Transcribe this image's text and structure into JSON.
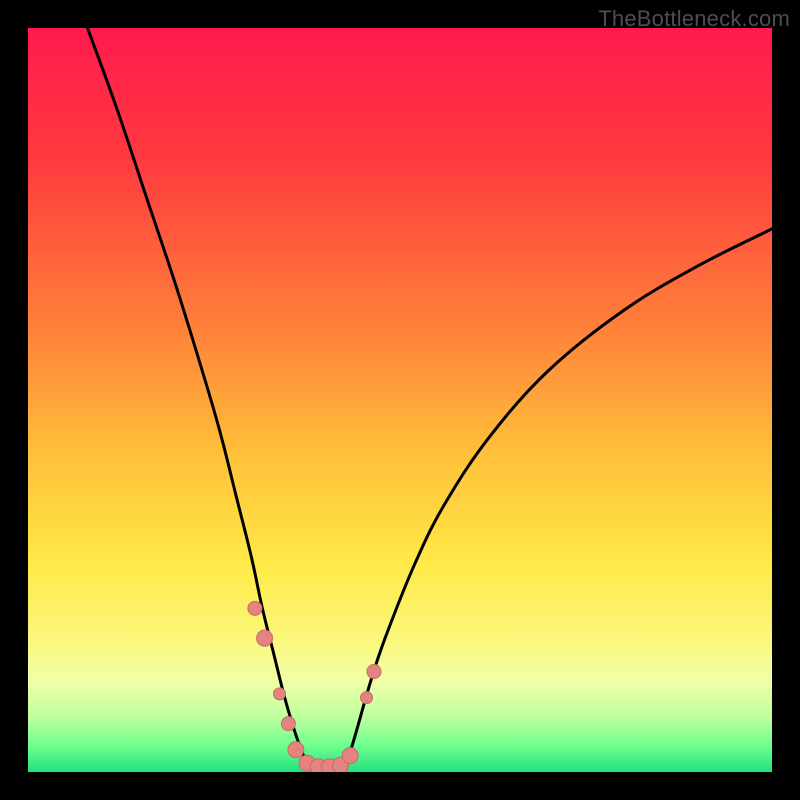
{
  "watermark": "TheBottleneck.com",
  "chart_data": {
    "type": "line",
    "title": "",
    "xlabel": "",
    "ylabel": "",
    "xlim": [
      0,
      100
    ],
    "ylim": [
      0,
      100
    ],
    "grid": false,
    "gradient_stops": [
      {
        "offset": 0,
        "color": "#ff1a4d"
      },
      {
        "offset": 0.18,
        "color": "#ff3b3f"
      },
      {
        "offset": 0.4,
        "color": "#ff803a"
      },
      {
        "offset": 0.58,
        "color": "#ffc23a"
      },
      {
        "offset": 0.72,
        "color": "#ffe947"
      },
      {
        "offset": 0.82,
        "color": "#fbf77a"
      },
      {
        "offset": 0.88,
        "color": "#efffa8"
      },
      {
        "offset": 0.93,
        "color": "#b8ff9e"
      },
      {
        "offset": 0.965,
        "color": "#6dff8e"
      },
      {
        "offset": 1.0,
        "color": "#24e07e"
      }
    ],
    "series": [
      {
        "name": "left-curve",
        "stroke": "#000000",
        "x": [
          8,
          12,
          16,
          20,
          24,
          26,
          28,
          30,
          31.5,
          33,
          34.5,
          36,
          37.5
        ],
        "y": [
          100,
          89,
          77,
          65,
          52,
          45,
          37,
          29,
          22,
          16,
          10,
          5,
          1
        ]
      },
      {
        "name": "right-curve",
        "stroke": "#000000",
        "x": [
          42.5,
          44,
          46,
          48,
          52,
          56,
          62,
          70,
          80,
          90,
          100
        ],
        "y": [
          0,
          5,
          12,
          18,
          28,
          36,
          45,
          54,
          62,
          68,
          73
        ]
      },
      {
        "name": "valley-floor",
        "stroke": "#000000",
        "x": [
          37.5,
          39,
          41,
          42.5
        ],
        "y": [
          1,
          0.2,
          0.2,
          0.5
        ]
      }
    ],
    "markers": {
      "name": "bottleneck-markers",
      "fill": "#e3847f",
      "stroke": "#c96a66",
      "points": [
        {
          "x": 30.5,
          "y": 22,
          "r": 7
        },
        {
          "x": 31.8,
          "y": 18,
          "r": 8
        },
        {
          "x": 33.8,
          "y": 10.5,
          "r": 6
        },
        {
          "x": 35.0,
          "y": 6.5,
          "r": 7
        },
        {
          "x": 36.0,
          "y": 3.0,
          "r": 8
        },
        {
          "x": 37.5,
          "y": 1.2,
          "r": 8
        },
        {
          "x": 39.0,
          "y": 0.7,
          "r": 8
        },
        {
          "x": 40.5,
          "y": 0.7,
          "r": 8
        },
        {
          "x": 42.0,
          "y": 0.9,
          "r": 8
        },
        {
          "x": 43.3,
          "y": 2.2,
          "r": 8
        },
        {
          "x": 45.5,
          "y": 10.0,
          "r": 6
        },
        {
          "x": 46.5,
          "y": 13.5,
          "r": 7
        }
      ]
    }
  }
}
